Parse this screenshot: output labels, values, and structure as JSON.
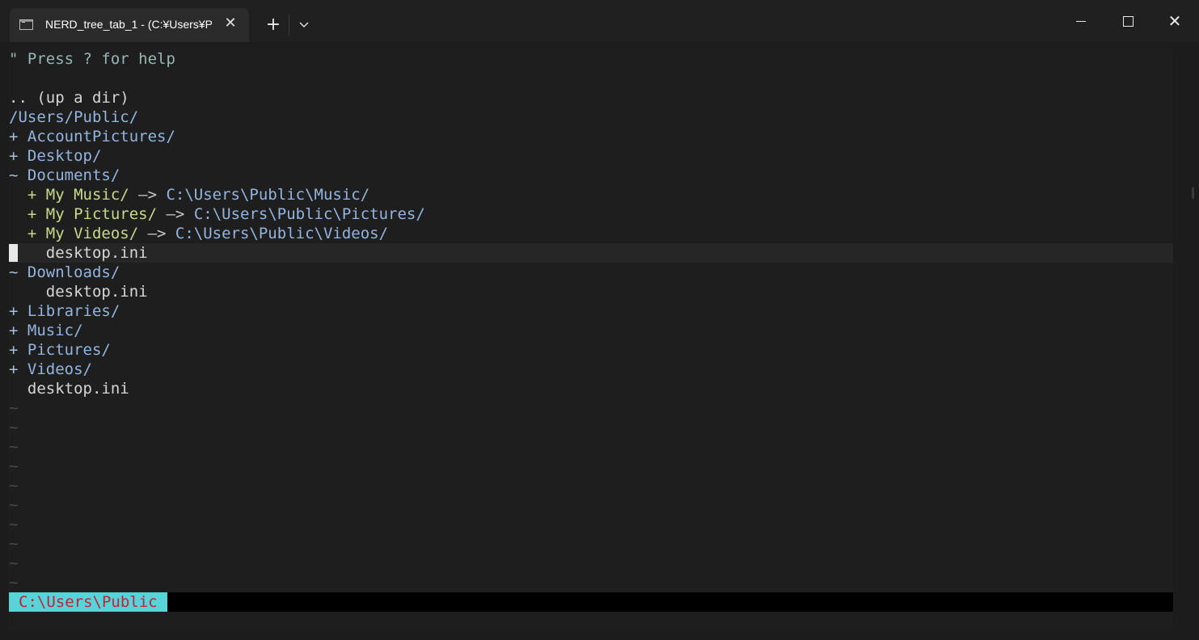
{
  "titlebar": {
    "tab_title": "NERD_tree_tab_1 - (C:¥Users¥P",
    "close_tab": "✕",
    "new_tab": "+",
    "dropdown": "⌄",
    "close_window": "✕"
  },
  "terminal": {
    "help_line": "\" Press ? for help",
    "up_dir": ".. (up a dir)",
    "root_path": "/Users/Public/",
    "tree": [
      {
        "marker": "+ ",
        "name": "AccountPictures/"
      },
      {
        "marker": "+ ",
        "name": "Desktop/"
      },
      {
        "marker": "~ ",
        "name": "Documents/"
      },
      {
        "marker": "  + ",
        "name": "My Music/",
        "arrow": " —> ",
        "target": "C:\\Users\\Public\\Music/"
      },
      {
        "marker": "  + ",
        "name": "My Pictures/",
        "arrow": " —> ",
        "target": "C:\\Users\\Public\\Pictures/"
      },
      {
        "marker": "  + ",
        "name": "My Videos/",
        "arrow": " —> ",
        "target": "C:\\Users\\Public\\Videos/"
      },
      {
        "marker": "    ",
        "name": "desktop.ini"
      },
      {
        "marker": "~ ",
        "name": "Downloads/"
      },
      {
        "marker": "    ",
        "name": "desktop.ini"
      },
      {
        "marker": "+ ",
        "name": "Libraries/"
      },
      {
        "marker": "+ ",
        "name": "Music/"
      },
      {
        "marker": "+ ",
        "name": "Pictures/"
      },
      {
        "marker": "+ ",
        "name": "Videos/"
      },
      {
        "marker": "  ",
        "name": "desktop.ini"
      }
    ],
    "tilde": "~",
    "status_path": "C:\\Users\\Public"
  },
  "colors": {
    "status_bg": "#56d4d8",
    "status_fg": "#c0223a",
    "dir": "#93b5e0",
    "link": "#c8d98a"
  }
}
